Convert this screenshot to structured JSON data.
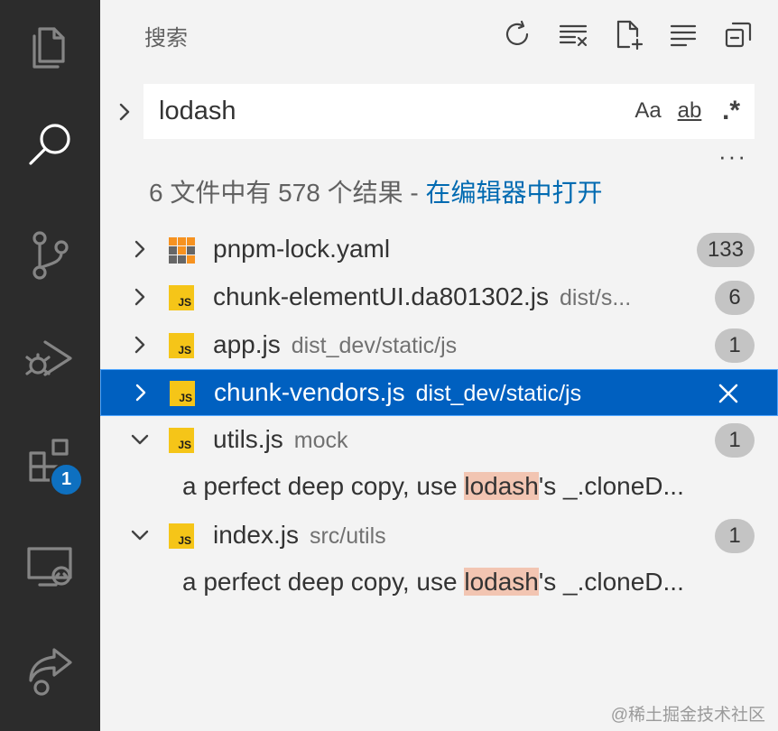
{
  "activity_bar": {
    "items": [
      {
        "name": "explorer",
        "icon": "files-icon"
      },
      {
        "name": "search",
        "icon": "search-icon",
        "active": true
      },
      {
        "name": "source-control",
        "icon": "source-control-icon"
      },
      {
        "name": "run-debug",
        "icon": "debug-icon"
      },
      {
        "name": "extensions",
        "icon": "extensions-icon",
        "badge": "1"
      },
      {
        "name": "remote-explorer",
        "icon": "remote-icon"
      },
      {
        "name": "live-share",
        "icon": "share-icon"
      }
    ]
  },
  "header": {
    "title": "搜索",
    "actions": [
      "refresh-icon",
      "clear-results-icon",
      "new-search-editor-icon",
      "collapse-all-icon",
      "view-as-tree-icon"
    ]
  },
  "search": {
    "value": "lodash",
    "opt_case": "Aa",
    "opt_word": "ab",
    "opt_regex": ".*",
    "more": "···"
  },
  "summary": {
    "text": "6 文件中有 578 个结果 - ",
    "link": "在编辑器中打开"
  },
  "results": [
    {
      "name": "pnpm-lock.yaml",
      "path": "",
      "count": "133",
      "expanded": false,
      "selected": false,
      "icon": "yaml"
    },
    {
      "name": "chunk-elementUI.da801302.js",
      "path": "dist/s...",
      "count": "6",
      "expanded": false,
      "selected": false,
      "icon": "js"
    },
    {
      "name": "app.js",
      "path": "dist_dev/static/js",
      "count": "1",
      "expanded": false,
      "selected": false,
      "icon": "js"
    },
    {
      "name": "chunk-vendors.js",
      "path": "dist_dev/static/js",
      "count": "",
      "expanded": false,
      "selected": true,
      "icon": "js"
    },
    {
      "name": "utils.js",
      "path": "mock",
      "count": "1",
      "expanded": true,
      "selected": false,
      "icon": "js",
      "match": {
        "before": "a perfect deep copy, use ",
        "hit": "lodash",
        "after": "'s _.cloneD..."
      }
    },
    {
      "name": "index.js",
      "path": "src/utils",
      "count": "1",
      "expanded": true,
      "selected": false,
      "icon": "js",
      "match": {
        "before": "a perfect deep copy, use ",
        "hit": "lodash",
        "after": "'s _.cloneD..."
      }
    }
  ],
  "icon_label": "JS",
  "watermark": "@稀土掘金技术社区",
  "colors": {
    "accent": "#0060c0",
    "link": "#006ab1",
    "highlight": "#f2c5b2",
    "badge": "#0e70c0"
  }
}
